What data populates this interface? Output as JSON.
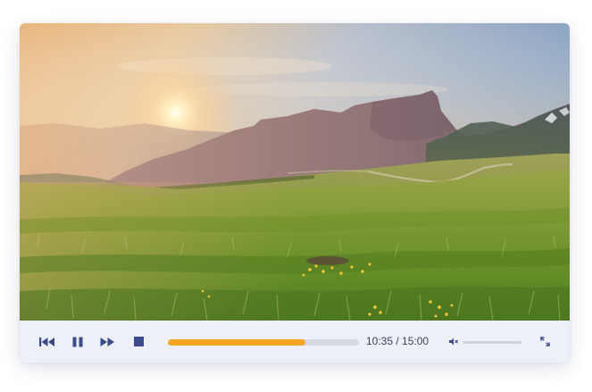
{
  "video": {
    "description_icon": "landscape-video-frame"
  },
  "controls": {
    "rewind_icon": "rewind-icon",
    "pause_icon": "pause-icon",
    "fast_forward_icon": "fast-forward-icon",
    "stop_icon": "stop-icon",
    "progress_fraction": 0.72,
    "time_display": "10:35 / 15:00",
    "volume_icon": "volume-mute-icon",
    "volume_fraction": 0.0,
    "fullscreen_icon": "fullscreen-icon"
  },
  "colors": {
    "accent": "#f5a623",
    "control_icon": "#3b4a8a",
    "bar_background": "#eef0f7"
  }
}
